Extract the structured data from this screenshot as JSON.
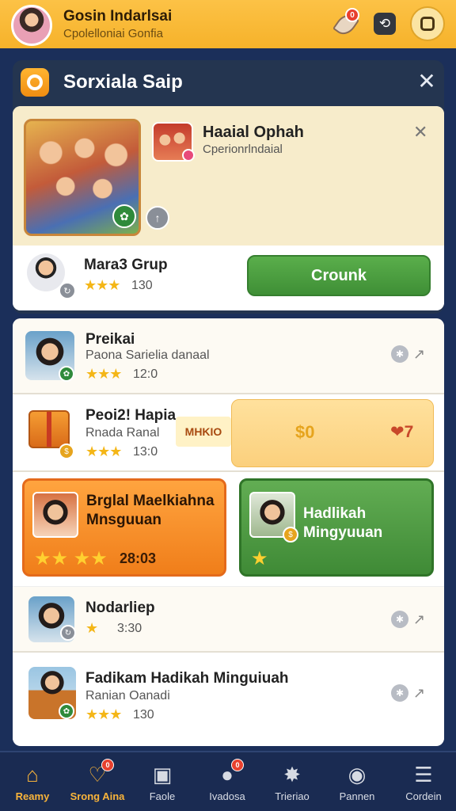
{
  "header": {
    "title": "Gosin Indarlsai",
    "subtitle": "Cpolelloniai Gonfia",
    "notification_count": "0"
  },
  "modal": {
    "title": "Sorxiala Saip",
    "close_glyph": "✕",
    "featured": {
      "title": "Haaial Ophah",
      "subtitle": "Cperionrlndaial"
    },
    "group": {
      "name": "Mara3 Grup",
      "stars": "★★★",
      "rating": "130",
      "action_label": "Crounk"
    }
  },
  "list": {
    "items": [
      {
        "title": "Preikai",
        "subtitle": "Paona Sarielia danaal",
        "stars": "★★★",
        "rating": "12:0"
      },
      {
        "title": "Peoi2! Hapia",
        "subtitle": "Rnada Ranal",
        "stars": "★★★",
        "rating": "13:0"
      },
      {
        "title": "Nodarliep",
        "subtitle": "",
        "stars": "★",
        "rating": "3:30"
      },
      {
        "title": "Fadikam Hadikah Minguiuah",
        "subtitle": "Ranian Oanadi",
        "stars": "★★★",
        "rating": "130"
      }
    ],
    "promo": {
      "tag": "MHKIO",
      "coin": "$0",
      "heart": "❤7"
    },
    "tiles": [
      {
        "title": "Brglal Maelkiahna Mnsguuan",
        "stars": "★★ ★★",
        "number": "28:03"
      },
      {
        "title": "Hadlikah Mingyuuan",
        "stars": "★"
      }
    ]
  },
  "nav": {
    "items": [
      {
        "label": "Reamy",
        "icon": "home-icon"
      },
      {
        "label": "Srong Aina",
        "icon": "heart-icon"
      },
      {
        "label": "Faole",
        "icon": "tv-icon"
      },
      {
        "label": "Ivadosa",
        "icon": "chat-icon"
      },
      {
        "label": "Trieriao",
        "icon": "puzzle-icon"
      },
      {
        "label": "Pannen",
        "icon": "disc-icon"
      },
      {
        "label": "Cordein",
        "icon": "menu-icon"
      }
    ]
  },
  "colors": {
    "topbar": "#f6b22a",
    "background": "#1b2f5a",
    "accent_green": "#3f8f36",
    "accent_orange": "#f07e1a",
    "star": "#f4b617"
  }
}
